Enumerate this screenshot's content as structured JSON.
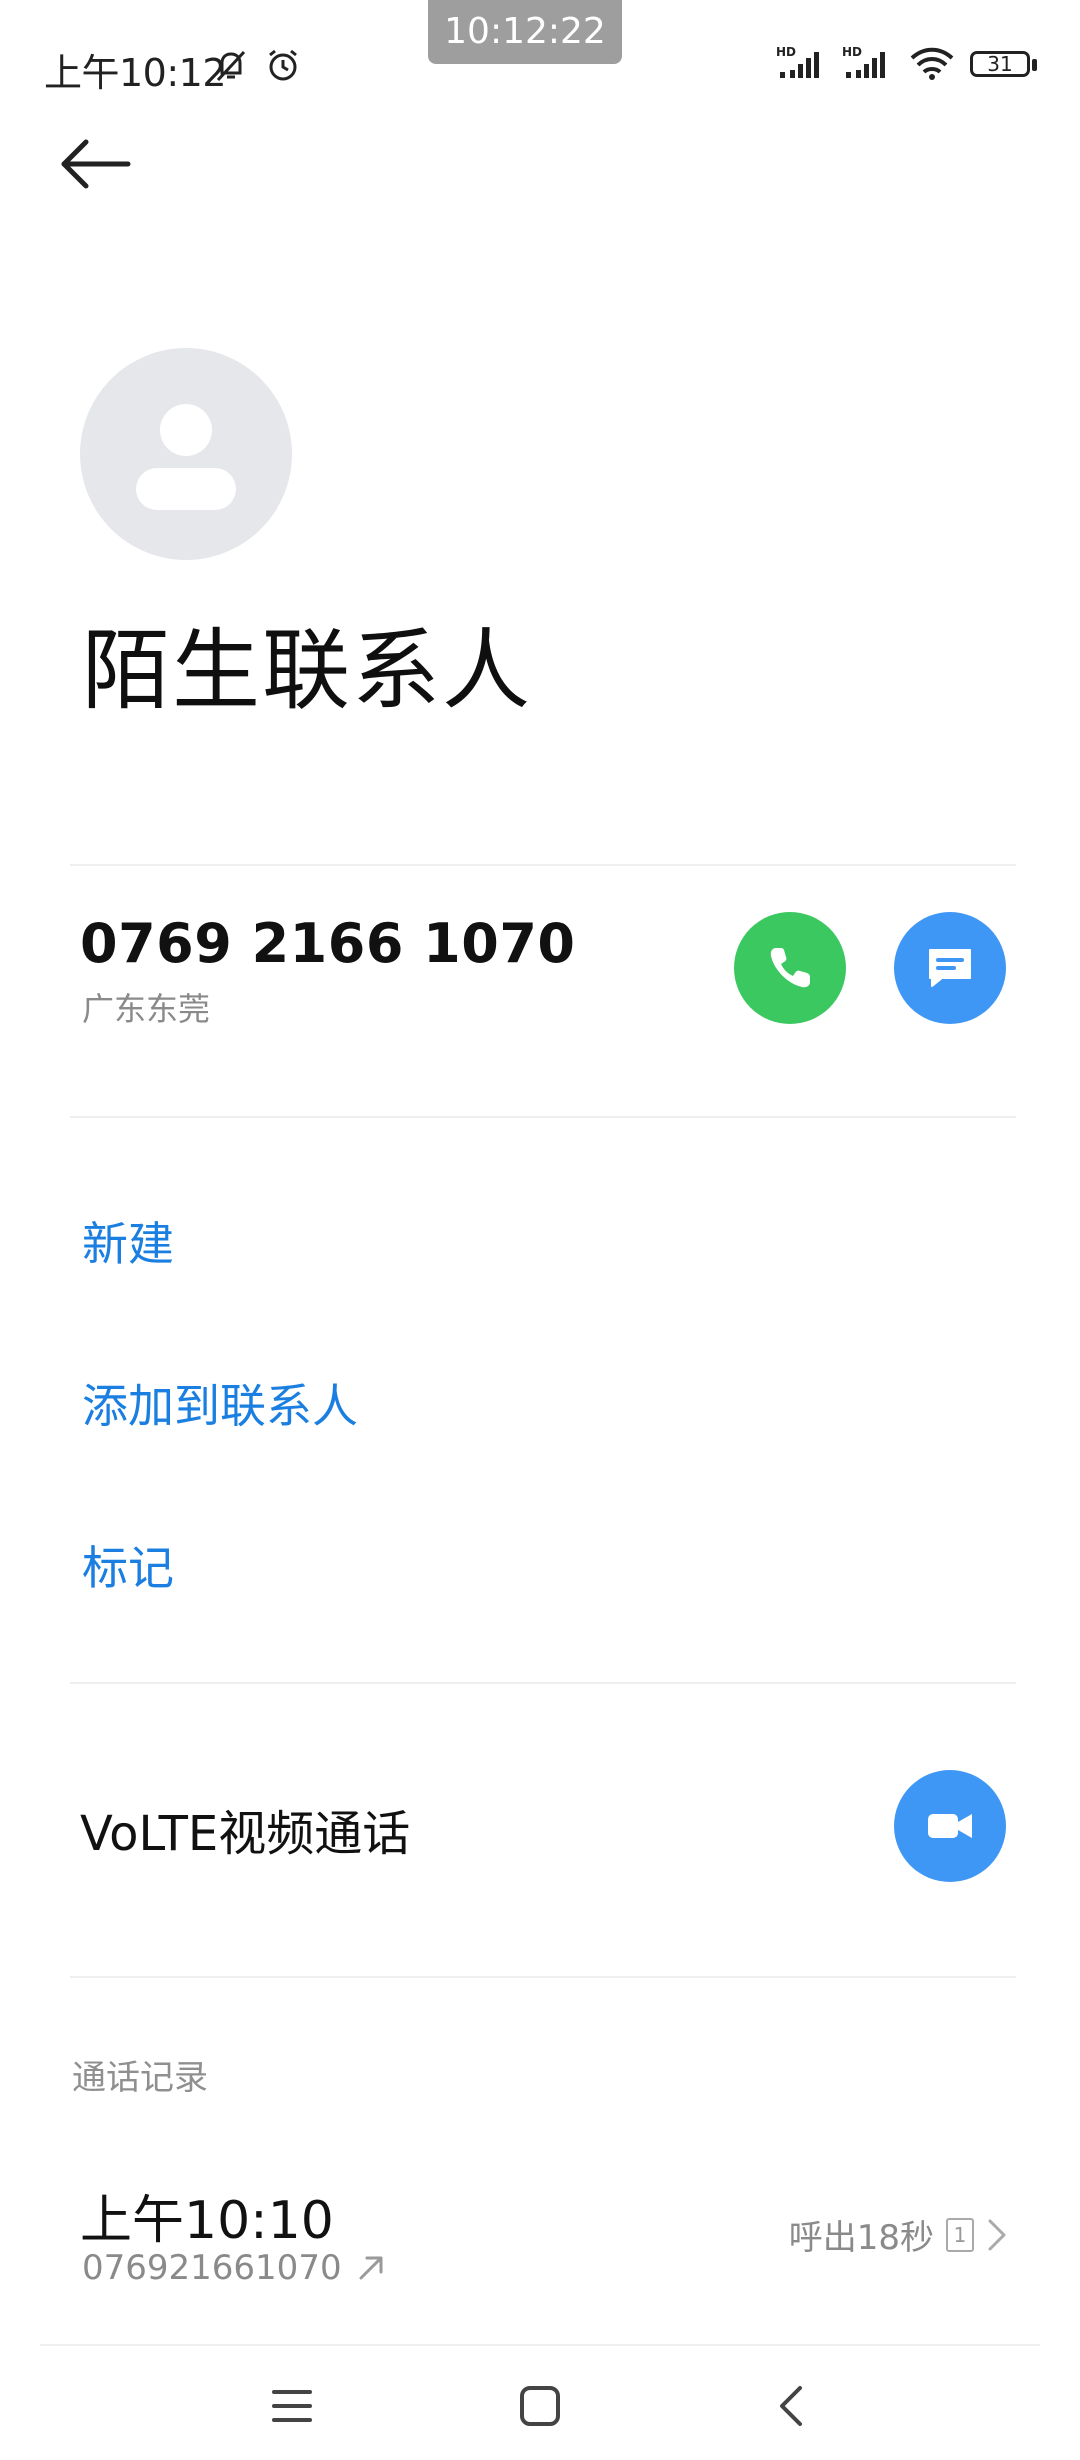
{
  "status_bar": {
    "time": "上午10:12",
    "center_clock": "10:12:22",
    "battery": "31"
  },
  "contact": {
    "name": "陌生联系人",
    "phone_number": "0769 2166 1070",
    "location": "广东东莞"
  },
  "actions": {
    "new_label": "新建",
    "add_to_contacts_label": "添加到联系人",
    "mark_label": "标记"
  },
  "video_call": {
    "label": "VoLTE视频通话"
  },
  "call_log": {
    "title": "通话记录",
    "entries": [
      {
        "time": "上午10:10",
        "number": "076921661070",
        "status": "呼出18秒",
        "sim": "1"
      }
    ]
  },
  "colors": {
    "accent_blue": "#3f97f5",
    "link_blue": "#1a7fe0",
    "call_green": "#3cc861"
  }
}
